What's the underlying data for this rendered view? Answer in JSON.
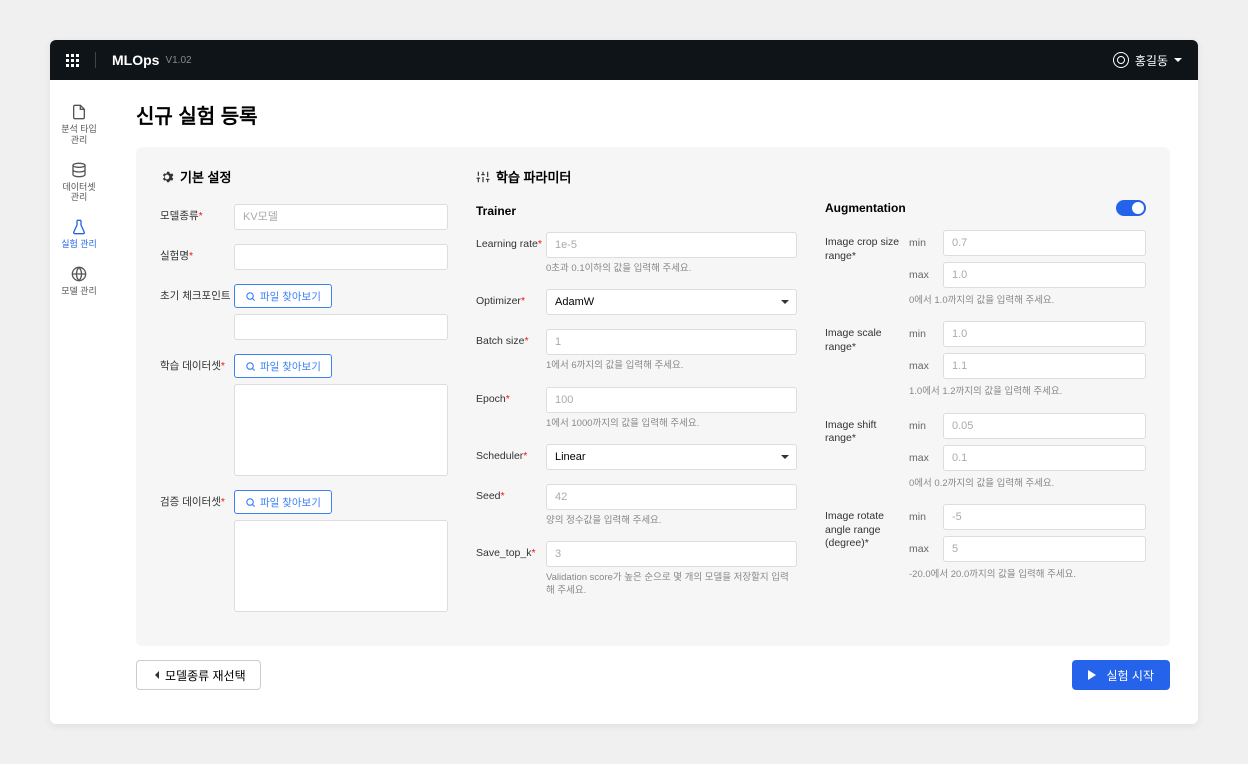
{
  "header": {
    "brand": "MLOps",
    "version": "V1.02",
    "user": "홍길동"
  },
  "sidebar": {
    "items": [
      {
        "label": "분석 타입\n관리"
      },
      {
        "label": "데이터셋\n관리"
      },
      {
        "label": "실험 관리"
      },
      {
        "label": "모델 관리"
      }
    ]
  },
  "page": {
    "title": "신규 실험 등록"
  },
  "basic": {
    "section_title": "기본 설정",
    "model_type": {
      "label": "모델종류",
      "placeholder": "KV모델"
    },
    "exp_name": {
      "label": "실험명"
    },
    "checkpoint": {
      "label": "초기 체크포인트",
      "btn": "파일 찾아보기"
    },
    "train_ds": {
      "label": "학습 데이터셋",
      "btn": "파일 찾아보기"
    },
    "valid_ds": {
      "label": "검증 데이터셋",
      "btn": "파일 찾아보기"
    }
  },
  "params": {
    "section_title": "학습 파라미터",
    "trainer_title": "Trainer",
    "lr": {
      "label": "Learning rate",
      "placeholder": "1e-5",
      "help": "0초과 0.1이하의 값을 입력해 주세요."
    },
    "optimizer": {
      "label": "Optimizer",
      "value": "AdamW"
    },
    "batch": {
      "label": "Batch size",
      "placeholder": "1",
      "help": "1에서 6까지의 값을 입력해 주세요."
    },
    "epoch": {
      "label": "Epoch",
      "placeholder": "100",
      "help": "1에서 1000까지의 값을 입력해 주세요."
    },
    "scheduler": {
      "label": "Scheduler",
      "value": "Linear"
    },
    "seed": {
      "label": "Seed",
      "placeholder": "42",
      "help": "양의 정수값을 입력해 주세요."
    },
    "topk": {
      "label": "Save_top_k",
      "placeholder": "3",
      "help": "Validation score가 높은 순으로 몇 개의 모델을 저장할지 입력해 주세요."
    }
  },
  "aug": {
    "title": "Augmentation",
    "crop": {
      "label": "Image crop size range",
      "min_label": "min",
      "max_label": "max",
      "min": "0.7",
      "max": "1.0",
      "help": "0에서 1.0까지의 값을 입력해 주세요."
    },
    "scale": {
      "label": "Image scale range",
      "min_label": "min",
      "max_label": "max",
      "min": "1.0",
      "max": "1.1",
      "help": "1.0에서 1.2까지의 값을 입력해 주세요."
    },
    "shift": {
      "label": "Image shift range",
      "min_label": "min",
      "max_label": "max",
      "min": "0.05",
      "max": "0.1",
      "help": "0에서 0.2까지의 값을 입력해 주세요."
    },
    "rotate": {
      "label": "Image rotate angle range (degree)",
      "min_label": "min",
      "max_label": "max",
      "min": "-5",
      "max": "5",
      "help": "-20.0에서 20.0까지의 값을 입력해 주세요."
    }
  },
  "footer": {
    "back": "모델종류 재선택",
    "start": "실험 시작"
  }
}
